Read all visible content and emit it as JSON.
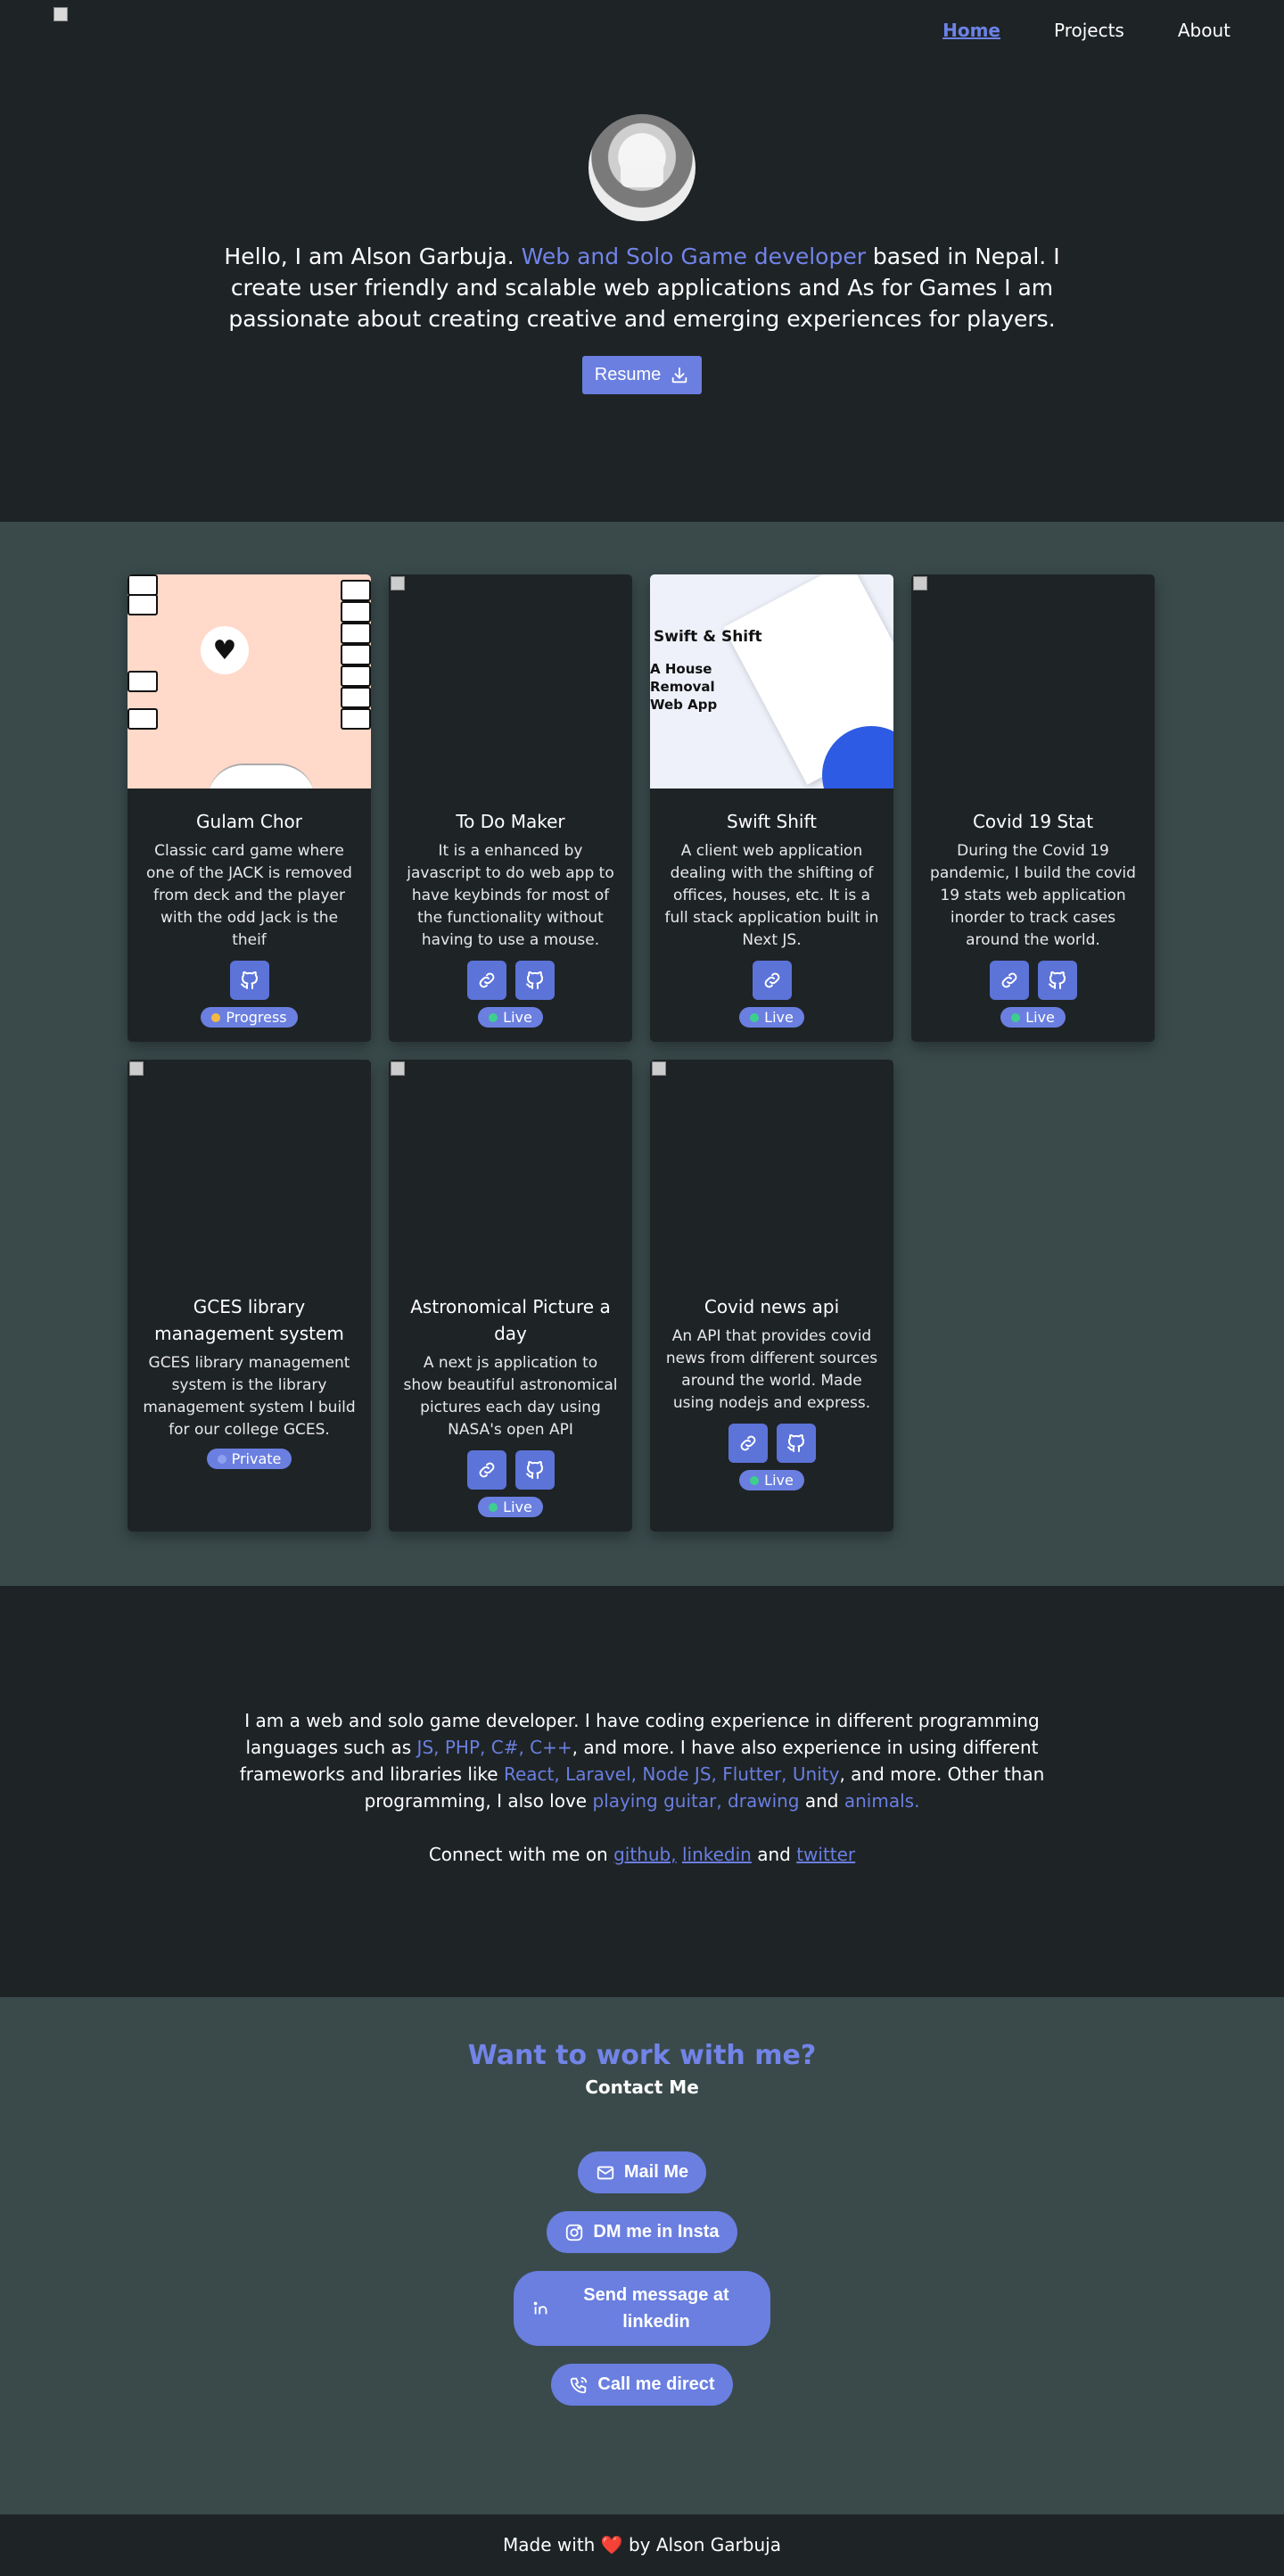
{
  "nav": {
    "items": [
      {
        "label": "Home",
        "active": true
      },
      {
        "label": "Projects",
        "active": false
      },
      {
        "label": "About",
        "active": false
      }
    ]
  },
  "hero": {
    "intro_before": "Hello, I am Alson Garbuja. ",
    "intro_accent": "Web and Solo Game developer",
    "intro_after": " based in Nepal. I create user friendly and scalable web applications and As for Games I am passionate about creating creative and emerging experiences for players.",
    "resume_label": "Resume"
  },
  "projects": [
    {
      "title": "Gulam Chor",
      "description": "Classic card game where one of the JACK is removed from deck and the player with the odd Jack is the theif",
      "status": "Progress",
      "status_color": "#f5b942",
      "links": [
        "github-icon"
      ],
      "thumb": "cards"
    },
    {
      "title": "To Do Maker",
      "description": "It is a enhanced by javascript to do web app to have keybinds for most of the functionality without having to use a mouse.",
      "status": "Live",
      "status_color": "#3ecf8e",
      "links": [
        "link-icon",
        "github-icon"
      ],
      "thumb": "broken"
    },
    {
      "title": "Swift Shift",
      "description": "A client web application dealing with the shifting of offices, houses, etc. It is a full stack application built in Next JS.",
      "status": "Live",
      "status_color": "#3ecf8e",
      "links": [
        "link-icon"
      ],
      "thumb": "swift",
      "thumb_brand": "Swift & Shift",
      "thumb_tag": "A House Removal Web App"
    },
    {
      "title": "Covid 19 Stat",
      "description": "During the Covid 19 pandemic, I build the covid 19 stats web application inorder to track cases around the world.",
      "status": "Live",
      "status_color": "#3ecf8e",
      "links": [
        "link-icon",
        "github-icon"
      ],
      "thumb": "broken"
    },
    {
      "title": "GCES library management system",
      "description": "GCES library management system is the library management system I build for our college GCES.",
      "status": "Private",
      "status_color": "#8ea0f0",
      "links": [],
      "thumb": "broken"
    },
    {
      "title": "Astronomical Picture a day",
      "description": "A next js application to show beautiful astronomical pictures each day using NASA's open API",
      "status": "Live",
      "status_color": "#3ecf8e",
      "links": [
        "link-icon",
        "github-icon"
      ],
      "thumb": "broken"
    },
    {
      "title": "Covid news api",
      "description": "An API that provides covid news from different sources around the world. Made using nodejs and express.",
      "status": "Live",
      "status_color": "#3ecf8e",
      "links": [
        "link-icon",
        "github-icon"
      ],
      "thumb": "broken"
    }
  ],
  "about": {
    "p1": "I am a web and solo game developer. I have coding experience in different programming languages such as ",
    "langs": "JS, PHP, C#, C++",
    "p2": ", and more. I have also experience in using different frameworks and libraries like ",
    "frameworks": "React, Laravel, Node JS, Flutter, Unity",
    "p3": ", and more. Other than programming, I also love ",
    "hobbies": "playing guitar, drawing",
    "and": " and ",
    "animals": "animals.",
    "connect_prefix": "Connect with me on ",
    "github": "github,",
    "linkedin": "linkedin",
    "connect_and": " and ",
    "twitter": "twitter"
  },
  "contact": {
    "heading": "Want to work with me?",
    "subheading": "Contact Me",
    "mail": "Mail Me",
    "insta": "DM me in Insta",
    "linkedin": "Send message at linkedin",
    "call": "Call me direct"
  },
  "footer": {
    "before": "Made with ",
    "heart": "❤️",
    "after": " by Alson Garbuja"
  },
  "colors": {
    "accent": "#6a7fe0",
    "dark": "#1e2326",
    "slate": "#3a4a4b"
  }
}
